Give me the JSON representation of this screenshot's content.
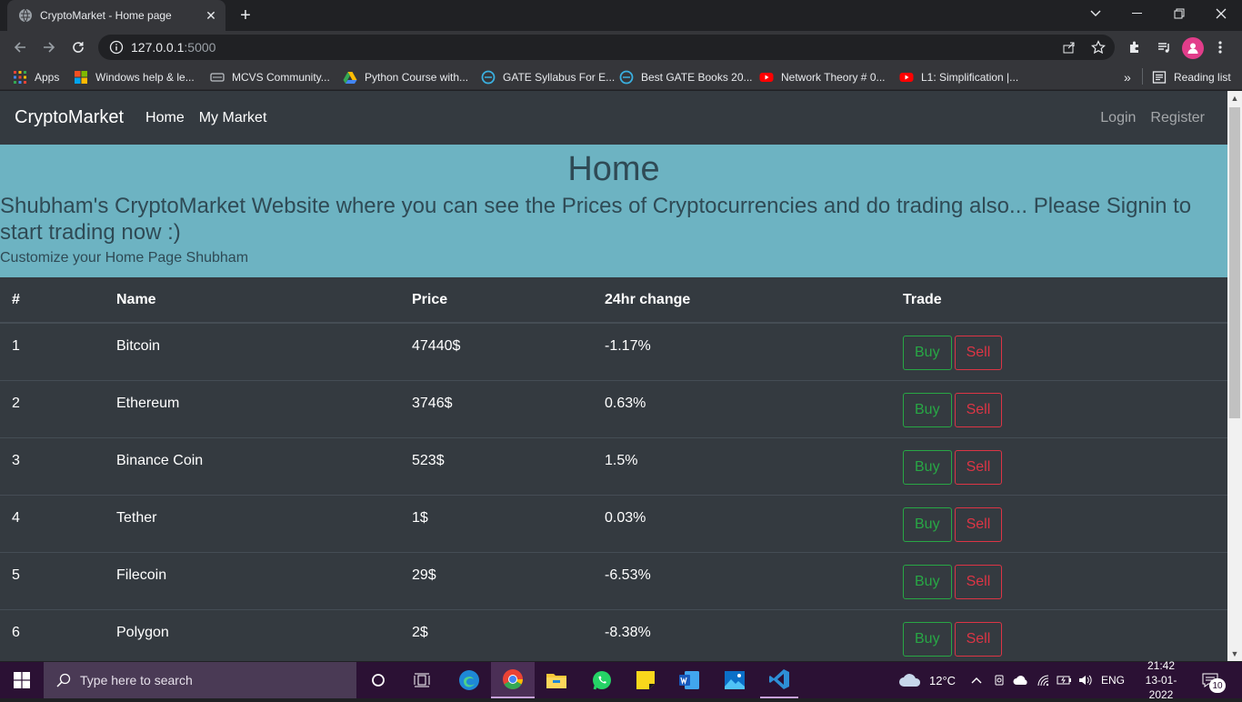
{
  "browser": {
    "tab_title": "CryptoMarket - Home page",
    "url_host": "127.0.0.1",
    "url_port": ":5000",
    "bookmarks": [
      {
        "label": "Apps",
        "icon": "apps-grid-icon"
      },
      {
        "label": "Windows help & le...",
        "icon": "windows-logo-icon"
      },
      {
        "label": "MCVS Community...",
        "icon": "card-icon"
      },
      {
        "label": "Python Course with...",
        "icon": "drive-icon"
      },
      {
        "label": "GATE Syllabus For E...",
        "icon": "edge-page-icon"
      },
      {
        "label": "Best GATE Books 20...",
        "icon": "edge-page-icon"
      },
      {
        "label": "Network Theory # 0...",
        "icon": "youtube-icon"
      },
      {
        "label": "L1: Simplification |...",
        "icon": "youtube-icon"
      }
    ],
    "reading_list": "Reading list",
    "overflow": "»"
  },
  "nav": {
    "brand": "CryptoMarket",
    "links": [
      "Home",
      "My Market"
    ],
    "login": "Login",
    "register": "Register"
  },
  "hero": {
    "title": "Home",
    "subtitle": "Shubham's CryptoMarket Website where you can see the Prices of Cryptocurrencies and do trading also... Please Signin to start trading now :)",
    "note": "Customize your Home Page Shubham"
  },
  "table": {
    "headers": [
      "#",
      "Name",
      "Price",
      "24hr change",
      "Trade"
    ],
    "rows": [
      {
        "num": "1",
        "name": "Bitcoin",
        "price": "47440$",
        "change": "-1.17%"
      },
      {
        "num": "2",
        "name": "Ethereum",
        "price": "3746$",
        "change": "0.63%"
      },
      {
        "num": "3",
        "name": "Binance Coin",
        "price": "523$",
        "change": "1.5%"
      },
      {
        "num": "4",
        "name": "Tether",
        "price": "1$",
        "change": "0.03%"
      },
      {
        "num": "5",
        "name": "Filecoin",
        "price": "29$",
        "change": "-6.53%"
      },
      {
        "num": "6",
        "name": "Polygon",
        "price": "2$",
        "change": "-8.38%"
      }
    ],
    "buy_label": "Buy",
    "sell_label": "Sell"
  },
  "taskbar": {
    "search_placeholder": "Type here to search",
    "weather": "12°C",
    "lang": "ENG",
    "time": "21:42",
    "date": "13-01-2022",
    "notifications": "10"
  },
  "colors": {
    "buy": "#28a745",
    "sell": "#dc3545",
    "hero_bg": "#6db3c2",
    "navbar_bg": "#343a40"
  }
}
